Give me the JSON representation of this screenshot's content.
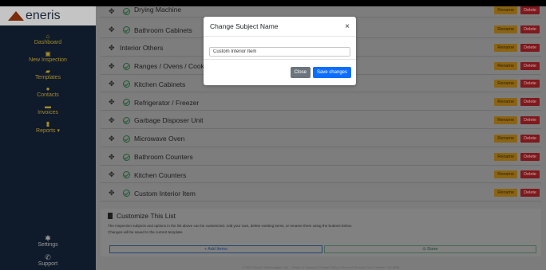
{
  "brand": {
    "name": "eneris"
  },
  "sidebar": {
    "items": [
      {
        "label": "Dashboard",
        "icon": "home-icon"
      },
      {
        "label": "New Inspection",
        "icon": "calendar-icon"
      },
      {
        "label": "Templates",
        "icon": "folder-icon"
      },
      {
        "label": "Contacts",
        "icon": "user-icon"
      },
      {
        "label": "Invoices",
        "icon": "invoice-icon"
      },
      {
        "label": "Reports ▾",
        "icon": "trash-icon"
      }
    ],
    "bottom": [
      {
        "label": "Settings",
        "icon": "gear-icon"
      },
      {
        "label": "Support",
        "icon": "phone-icon"
      }
    ]
  },
  "rows": [
    {
      "label": "Drying Machine",
      "checked": true
    },
    {
      "label": "Bathroom Cabinets",
      "checked": true
    },
    {
      "label": "Interior Others",
      "checked": false
    },
    {
      "label": "Ranges / Ovens / Cooktops",
      "checked": true
    },
    {
      "label": "Kitchen Cabinets",
      "checked": true
    },
    {
      "label": "Refrigerator / Freezer",
      "checked": true
    },
    {
      "label": "Garbage Disposer Unit",
      "checked": true
    },
    {
      "label": "Microwave Oven",
      "checked": true
    },
    {
      "label": "Bathroom Counters",
      "checked": true
    },
    {
      "label": "Kitchen Counters",
      "checked": true
    },
    {
      "label": "Custom Interior Item",
      "checked": true
    }
  ],
  "row_buttons": {
    "rename": "Rename",
    "delete": "Delete"
  },
  "customize": {
    "title": "Customize This List",
    "desc1": "The inspection subjects and options in the list above can be customized. Add your own, delete existing items, or rename them using the buttons below.",
    "desc2": "Changes will be saved to the current template.",
    "add_label": "+ Add Items",
    "done_label": "⊙ Done"
  },
  "footer": "© 2023 Eneris Technologies, Inc. – Made in Canada | Privacy Policy | Terms of Service | Ver | Version: 1.0.6894",
  "modal": {
    "title": "Change Subject Name",
    "close_icon": "×",
    "input_value": "Custom Interior Item",
    "close_label": "Close",
    "save_label": "Save changes"
  }
}
